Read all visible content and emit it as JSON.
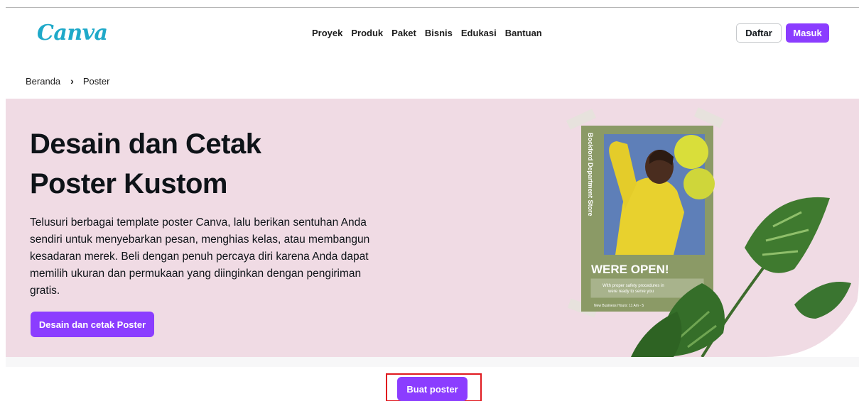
{
  "header": {
    "logo": "Canva",
    "nav": [
      "Proyek",
      "Produk",
      "Paket",
      "Bisnis",
      "Edukasi",
      "Bantuan"
    ],
    "signup_label": "Daftar",
    "login_label": "Masuk"
  },
  "breadcrumb": {
    "home": "Beranda",
    "current": "Poster"
  },
  "hero": {
    "title_line1": "Desain dan Cetak",
    "title_line2": "Poster Kustom",
    "description": "Telusuri berbagai template poster Canva, lalu berikan sentuhan Anda sendiri untuk menyebarkan pesan, menghias kelas, atau membangun kesadaran merek. Beli dengan penuh percaya diri karena Anda dapat memilih ukuran dan permukaan yang diinginkan dengan pengiriman gratis.",
    "cta_label": "Desain dan cetak Poster",
    "poster": {
      "vertical_text": "Bockford Department Store",
      "headline": "WERE OPEN!",
      "subtext_line1": "With proper safety procedures in",
      "subtext_line2": "were ready to serve you",
      "footer": "New Business Hours: 11 Am - 5"
    }
  },
  "bottom": {
    "create_label": "Buat poster"
  },
  "colors": {
    "brand_purple": "#8b3dff",
    "hero_bg": "#f0dbe4",
    "highlight_red": "#e0191f"
  }
}
